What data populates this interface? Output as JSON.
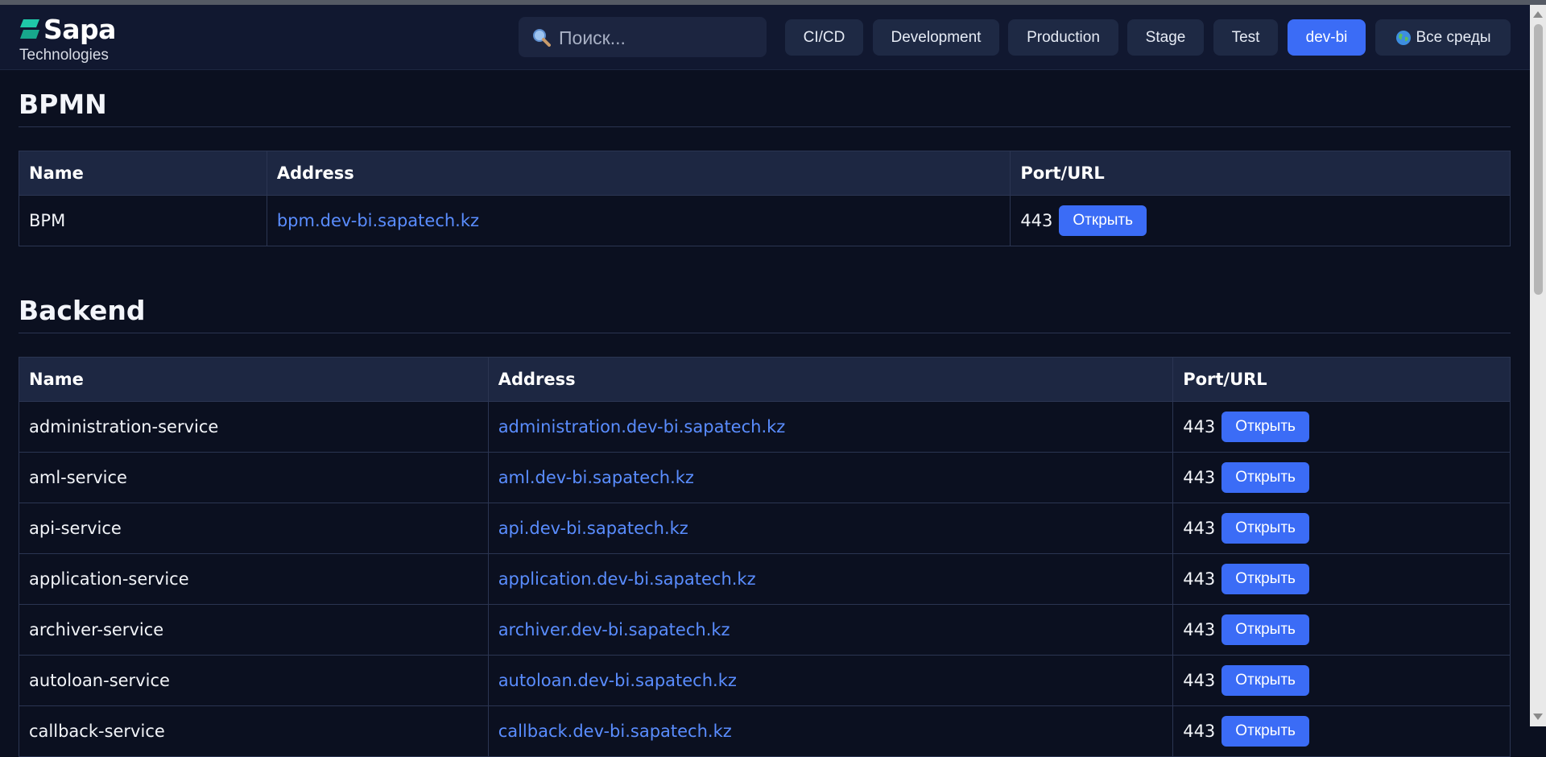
{
  "logo": {
    "name": "Sapa",
    "subtitle": "Technologies"
  },
  "search": {
    "placeholder": "Поиск..."
  },
  "env_buttons": [
    "CI/CD",
    "Development",
    "Production",
    "Stage",
    "Test",
    "dev-bi",
    "Все среды"
  ],
  "active_env": "dev-bi",
  "colors": {
    "accent": "#3b6cf6",
    "background": "#0b1020",
    "link": "#5a8dff"
  },
  "table_headers": {
    "name": "Name",
    "address": "Address",
    "port": "Port/URL"
  },
  "open_label": "Открыть",
  "sections": [
    {
      "title": "BPMN",
      "rows": [
        {
          "name": "BPM",
          "address": "bpm.dev-bi.sapatech.kz",
          "port": "443"
        }
      ]
    },
    {
      "title": "Backend",
      "rows": [
        {
          "name": "administration-service",
          "address": "administration.dev-bi.sapatech.kz",
          "port": "443"
        },
        {
          "name": "aml-service",
          "address": "aml.dev-bi.sapatech.kz",
          "port": "443"
        },
        {
          "name": "api-service",
          "address": "api.dev-bi.sapatech.kz",
          "port": "443"
        },
        {
          "name": "application-service",
          "address": "application.dev-bi.sapatech.kz",
          "port": "443"
        },
        {
          "name": "archiver-service",
          "address": "archiver.dev-bi.sapatech.kz",
          "port": "443"
        },
        {
          "name": "autoloan-service",
          "address": "autoloan.dev-bi.sapatech.kz",
          "port": "443"
        },
        {
          "name": "callback-service",
          "address": "callback.dev-bi.sapatech.kz",
          "port": "443"
        }
      ]
    }
  ]
}
